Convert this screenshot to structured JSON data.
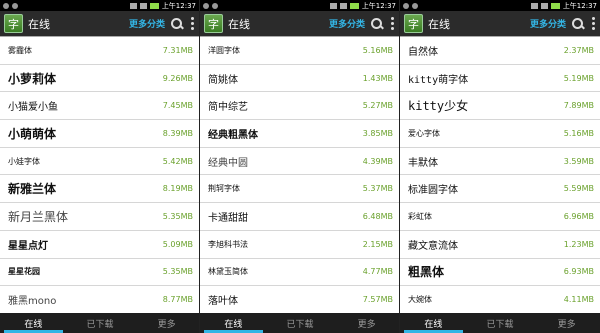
{
  "status": {
    "time": "上午12:37"
  },
  "actionbar": {
    "title": "在线",
    "more_label": "更多分类",
    "app_icon_char": "字"
  },
  "tabs": [
    "在线",
    "已下载",
    "更多"
  ],
  "columns": [
    [
      {
        "name": "雾霾体",
        "size": "7.31MB"
      },
      {
        "name": "小萝莉体",
        "size": "9.26MB"
      },
      {
        "name": "小猫爱小鱼",
        "size": "7.45MB"
      },
      {
        "name": "小萌萌体",
        "size": "8.39MB"
      },
      {
        "name": "小娃字体",
        "size": "5.42MB"
      },
      {
        "name": "新雅兰体",
        "size": "8.19MB"
      },
      {
        "name": "新月兰黑体",
        "size": "5.35MB"
      },
      {
        "name": "星星点灯",
        "size": "5.09MB"
      },
      {
        "name": "星星花园",
        "size": "5.35MB"
      },
      {
        "name": "雅黑mono",
        "size": "8.77MB"
      }
    ],
    [
      {
        "name": "洋圆字体",
        "size": "5.16MB"
      },
      {
        "name": "简姚体",
        "size": "1.43MB"
      },
      {
        "name": "简中综艺",
        "size": "5.27MB"
      },
      {
        "name": "经典粗黑体",
        "size": "3.85MB"
      },
      {
        "name": "经典中圆",
        "size": "4.39MB"
      },
      {
        "name": "荆轲字体",
        "size": "5.37MB"
      },
      {
        "name": "卡通甜甜",
        "size": "6.48MB"
      },
      {
        "name": "李旭科书法",
        "size": "2.15MB"
      },
      {
        "name": "林黛玉简体",
        "size": "4.77MB"
      },
      {
        "name": "落叶体",
        "size": "7.57MB"
      }
    ],
    [
      {
        "name": "自然体",
        "size": "2.37MB"
      },
      {
        "name": "kitty萌字体",
        "size": "5.19MB"
      },
      {
        "name": "kitty少女",
        "size": "7.89MB"
      },
      {
        "name": "爱心字体",
        "size": "5.16MB"
      },
      {
        "name": "丰默体",
        "size": "3.59MB"
      },
      {
        "name": "标准圆字体",
        "size": "5.59MB"
      },
      {
        "name": "彩虹体",
        "size": "6.96MB"
      },
      {
        "name": "藏文意流体",
        "size": "1.23MB"
      },
      {
        "name": "粗黑体",
        "size": "6.93MB"
      },
      {
        "name": "大婉体",
        "size": "4.11MB"
      }
    ]
  ]
}
